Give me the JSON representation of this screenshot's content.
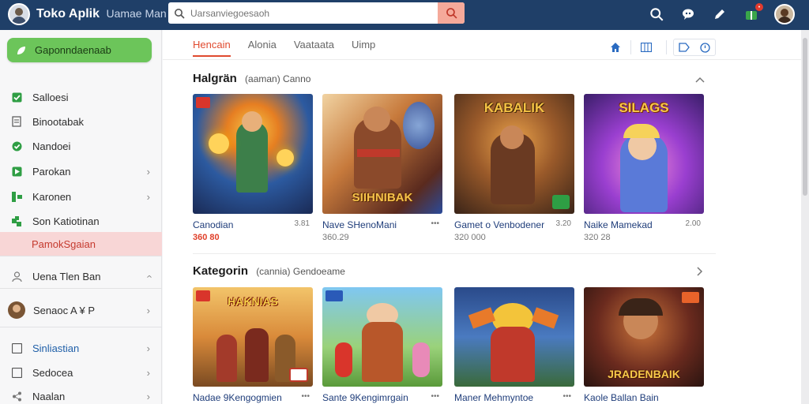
{
  "app": {
    "title": "Toko Aplik",
    "subtitle": "Uamae Man"
  },
  "search": {
    "placeholder": "Uarsanviegoesaoh"
  },
  "sidebar": {
    "cta_label": "Gaponndaenaab",
    "items": [
      {
        "label": "Salloesi",
        "icon": "checkbox-checked-icon"
      },
      {
        "label": "Binootabak",
        "icon": "document-icon"
      },
      {
        "label": "Nandoei",
        "icon": "checkbox-checked-icon"
      },
      {
        "label": "Parokan",
        "icon": "flag-icon"
      },
      {
        "label": "Karonen",
        "icon": "grid-icon"
      },
      {
        "label": "Son Katiotinan",
        "icon": "puzzle-icon"
      },
      {
        "label": "PamokSgaian",
        "icon": ""
      },
      {
        "label": "Uena Tlen Ban",
        "icon": "person-icon"
      },
      {
        "label": "Senaoc A ¥ P",
        "icon": "avatar"
      },
      {
        "label": "Sinliastian",
        "icon": "square-icon"
      },
      {
        "label": "Sedocea",
        "icon": "square-icon"
      },
      {
        "label": "Naalan",
        "icon": "share-icon"
      }
    ]
  },
  "tabs": [
    "Hencain",
    "Alonia",
    "Vaataata",
    "Uimp"
  ],
  "sections": [
    {
      "title": "Halgrän",
      "meta": "(aaman)  Canno",
      "cards": [
        {
          "title": "Canodian",
          "meta": "3.81",
          "price": "360 80",
          "hot": true
        },
        {
          "title": "Nave SHenoMani",
          "meta": "•••",
          "price": "360.29",
          "hot": false
        },
        {
          "title": "Gamet o Venbodener",
          "meta": "3.20",
          "price": "320  000",
          "hot": false
        },
        {
          "title": "Naike Mamekad",
          "meta": "2.00",
          "price": "320 28",
          "hot": false
        }
      ]
    },
    {
      "title": "Kategorin",
      "meta": "(cannia)  Gendoeame",
      "cards": [
        {
          "title": "Nadae 9Kengogmien",
          "meta": "•••",
          "price": "",
          "hot": false
        },
        {
          "title": "Sante 9Kengimrgain",
          "meta": "•••",
          "price": "",
          "hot": false
        },
        {
          "title": "Maner Mehmyntoe",
          "meta": "•••",
          "price": "",
          "hot": false
        },
        {
          "title": "Kaole Ballan Bain",
          "meta": "",
          "price": "",
          "hot": false
        }
      ]
    }
  ],
  "thumb_text": {
    "s0c1": "SIIHNIBAK",
    "s0c2": "KABALIK",
    "s0c3": "SILAGS",
    "s1c0": "HAKNIAS",
    "s1c3": "JRADENBAIK"
  },
  "colors": {
    "topbar": "#1f3f68",
    "accent": "#e04a2f",
    "cta": "#6cc55a",
    "link": "#1f3d7a"
  }
}
